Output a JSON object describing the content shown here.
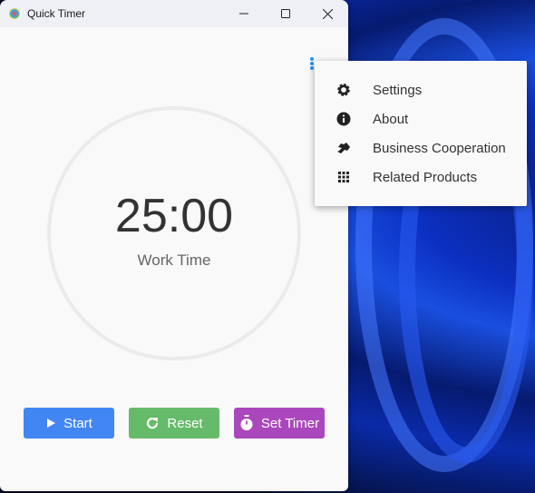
{
  "window": {
    "title": "Quick Timer"
  },
  "timer": {
    "time": "25:00",
    "mode": "Work Time"
  },
  "buttons": {
    "start": "Start",
    "reset": "Reset",
    "set_timer": "Set Timer"
  },
  "menu": {
    "items": [
      {
        "label": "Settings",
        "icon": "gear-icon"
      },
      {
        "label": "About",
        "icon": "info-icon"
      },
      {
        "label": "Business Cooperation",
        "icon": "handshake-icon"
      },
      {
        "label": "Related Products",
        "icon": "grid-icon"
      }
    ]
  },
  "colors": {
    "start": "#4286f4",
    "reset": "#66bb6a",
    "set_timer": "#ab47bc",
    "kebab": "#2196f3"
  }
}
